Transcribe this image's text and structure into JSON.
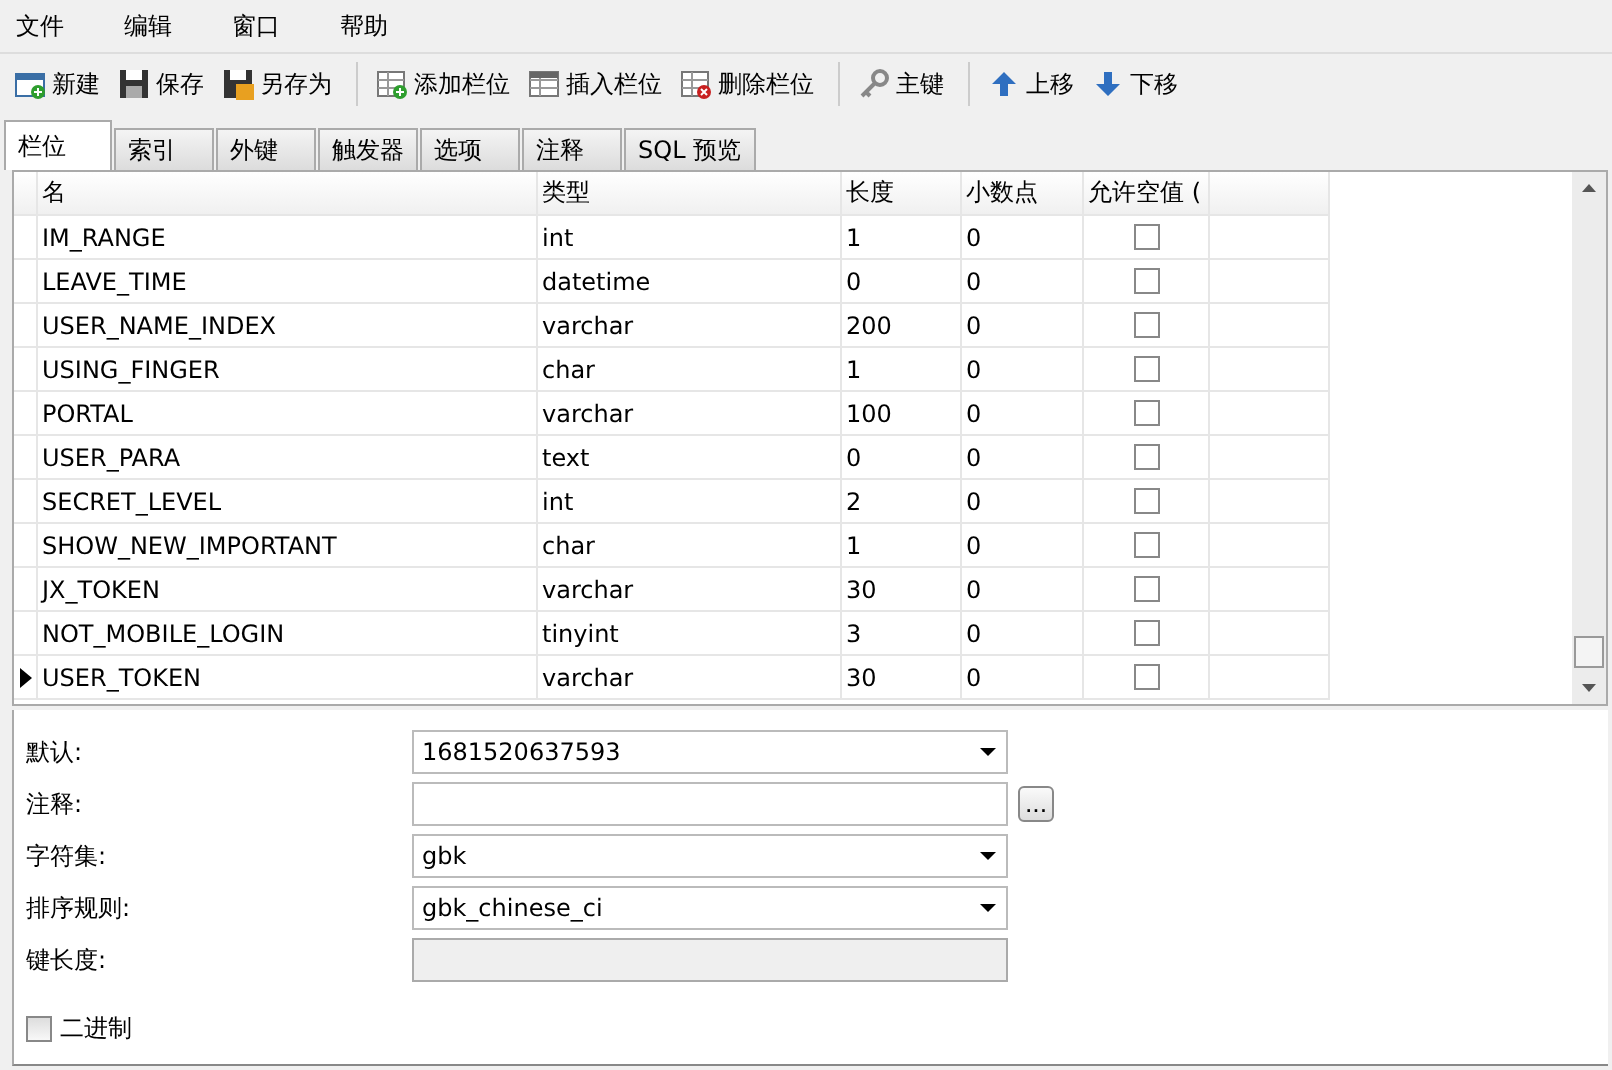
{
  "menu": [
    "文件",
    "编辑",
    "窗口",
    "帮助"
  ],
  "toolbar": [
    {
      "kind": "new",
      "label": "新建"
    },
    {
      "kind": "save",
      "label": "保存"
    },
    {
      "kind": "saveas",
      "label": "另存为"
    },
    {
      "kind": "sep"
    },
    {
      "kind": "addcol",
      "label": "添加栏位"
    },
    {
      "kind": "inscol",
      "label": "插入栏位"
    },
    {
      "kind": "delcol",
      "label": "删除栏位"
    },
    {
      "kind": "sep"
    },
    {
      "kind": "key",
      "label": "主键"
    },
    {
      "kind": "sep"
    },
    {
      "kind": "up",
      "label": "上移"
    },
    {
      "kind": "down",
      "label": "下移"
    }
  ],
  "tabs": [
    {
      "label": "栏位",
      "selected": true
    },
    {
      "label": "索引",
      "selected": false
    },
    {
      "label": "外键",
      "selected": false
    },
    {
      "label": "触发器",
      "selected": false
    },
    {
      "label": "选项",
      "selected": false
    },
    {
      "label": "注释",
      "selected": false
    },
    {
      "label": "SQL 预览",
      "selected": false
    }
  ],
  "table": {
    "columns": [
      "名",
      "类型",
      "长度",
      "小数点",
      "允许空值 ("
    ],
    "rows": [
      {
        "name": "IM_RANGE",
        "type": "int",
        "length": "1",
        "decimals": "0",
        "nullable": false,
        "selected": false
      },
      {
        "name": "LEAVE_TIME",
        "type": "datetime",
        "length": "0",
        "decimals": "0",
        "nullable": false,
        "selected": false
      },
      {
        "name": "USER_NAME_INDEX",
        "type": "varchar",
        "length": "200",
        "decimals": "0",
        "nullable": false,
        "selected": false
      },
      {
        "name": "USING_FINGER",
        "type": "char",
        "length": "1",
        "decimals": "0",
        "nullable": false,
        "selected": false
      },
      {
        "name": "PORTAL",
        "type": "varchar",
        "length": "100",
        "decimals": "0",
        "nullable": false,
        "selected": false
      },
      {
        "name": "USER_PARA",
        "type": "text",
        "length": "0",
        "decimals": "0",
        "nullable": false,
        "selected": false
      },
      {
        "name": "SECRET_LEVEL",
        "type": "int",
        "length": "2",
        "decimals": "0",
        "nullable": false,
        "selected": false
      },
      {
        "name": "SHOW_NEW_IMPORTANT",
        "type": "char",
        "length": "1",
        "decimals": "0",
        "nullable": false,
        "selected": false
      },
      {
        "name": "JX_TOKEN",
        "type": "varchar",
        "length": "30",
        "decimals": "0",
        "nullable": false,
        "selected": false
      },
      {
        "name": "NOT_MOBILE_LOGIN",
        "type": "tinyint",
        "length": "3",
        "decimals": "0",
        "nullable": false,
        "selected": false
      },
      {
        "name": "USER_TOKEN",
        "type": "varchar",
        "length": "30",
        "decimals": "0",
        "nullable": false,
        "selected": true
      }
    ]
  },
  "properties": [
    {
      "kind": "dropdown",
      "label": "默认:",
      "value": "1681520637593"
    },
    {
      "kind": "text",
      "label": "注释:",
      "button": "..."
    },
    {
      "kind": "dropdown",
      "label": "字符集:",
      "value": "gbk"
    },
    {
      "kind": "dropdown",
      "label": "排序规则:",
      "value": "gbk_chinese_ci"
    },
    {
      "kind": "disabled",
      "label": "键长度:"
    }
  ],
  "binary": {
    "label": "二进制",
    "checked": false
  }
}
